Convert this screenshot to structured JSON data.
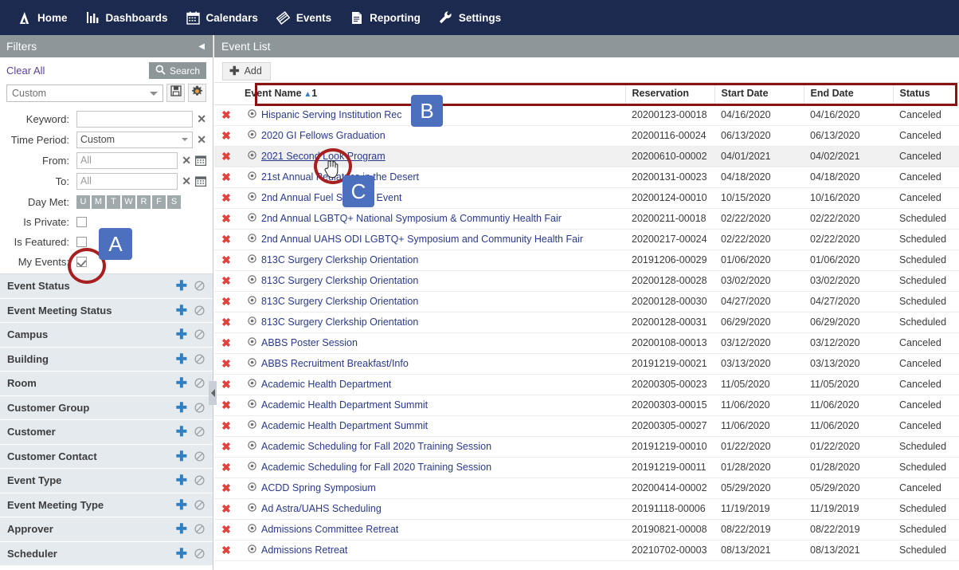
{
  "topnav": {
    "items": [
      {
        "label": "Home",
        "icon": "logo-a-icon"
      },
      {
        "label": "Dashboards",
        "icon": "bar-chart-icon"
      },
      {
        "label": "Calendars",
        "icon": "calendar-icon"
      },
      {
        "label": "Events",
        "icon": "diamond-icon"
      },
      {
        "label": "Reporting",
        "icon": "document-icon"
      },
      {
        "label": "Settings",
        "icon": "wrench-icon"
      }
    ]
  },
  "sidebar": {
    "header_title": "Filters",
    "collapse_icon": "chevron-left-icon",
    "clear_all": "Clear All",
    "search_label": "Search",
    "search_icon": "search-icon",
    "saved_filter_value": "Custom",
    "save_icon": "save-disk-icon",
    "settings_icon": "gear-icon",
    "filters": [
      {
        "label": "Keyword:",
        "value": "",
        "type": "text",
        "clear_icon": "clear-x-icon"
      },
      {
        "label": "Time Period:",
        "value": "Custom",
        "type": "select",
        "clear_icon": "clear-x-icon"
      },
      {
        "label": "From:",
        "value": "All",
        "type": "date",
        "clear_icon": "clear-x-icon",
        "cal_icon": "calendar-icon"
      },
      {
        "label": "To:",
        "value": "All",
        "type": "date",
        "clear_icon": "clear-x-icon",
        "cal_icon": "calendar-icon"
      }
    ],
    "day_met_label": "Day Met:",
    "day_met": [
      "U",
      "M",
      "T",
      "W",
      "R",
      "F",
      "S"
    ],
    "checkboxes": [
      {
        "label": "Is Private:",
        "checked": false
      },
      {
        "label": "Is Featured:",
        "checked": false
      },
      {
        "label": "My Events:",
        "checked": true
      }
    ],
    "accordion": [
      {
        "label": "Event Status",
        "add_icon": "plus-icon",
        "exclude_icon": "no-entry-icon"
      },
      {
        "label": "Event Meeting Status",
        "add_icon": "plus-icon",
        "exclude_icon": "no-entry-icon"
      },
      {
        "label": "Campus",
        "add_icon": "plus-icon",
        "exclude_icon": "no-entry-icon"
      },
      {
        "label": "Building",
        "add_icon": "plus-icon",
        "exclude_icon": "no-entry-icon"
      },
      {
        "label": "Room",
        "add_icon": "plus-icon",
        "exclude_icon": "no-entry-icon"
      },
      {
        "label": "Customer Group",
        "add_icon": "plus-icon",
        "exclude_icon": "no-entry-icon"
      },
      {
        "label": "Customer",
        "add_icon": "plus-icon",
        "exclude_icon": "no-entry-icon"
      },
      {
        "label": "Customer Contact",
        "add_icon": "plus-icon",
        "exclude_icon": "no-entry-icon"
      },
      {
        "label": "Event Type",
        "add_icon": "plus-icon",
        "exclude_icon": "no-entry-icon"
      },
      {
        "label": "Event Meeting Type",
        "add_icon": "plus-icon",
        "exclude_icon": "no-entry-icon"
      },
      {
        "label": "Approver",
        "add_icon": "plus-icon",
        "exclude_icon": "no-entry-icon"
      },
      {
        "label": "Scheduler",
        "add_icon": "plus-icon",
        "exclude_icon": "no-entry-icon"
      }
    ]
  },
  "main": {
    "header_title": "Event List",
    "add_label": "Add",
    "add_icon": "plus-icon",
    "columns": [
      {
        "key": "delete",
        "label": ""
      },
      {
        "key": "name",
        "label": "Event Name",
        "sorted": true,
        "sort_dir": "asc",
        "sort_order": "1"
      },
      {
        "key": "reservation",
        "label": "Reservation"
      },
      {
        "key": "start",
        "label": "Start Date"
      },
      {
        "key": "end",
        "label": "End Date"
      },
      {
        "key": "status",
        "label": "Status"
      }
    ],
    "sort_indicator": "▲",
    "rows": [
      {
        "name": "Hispanic Serving Institution Rec",
        "reservation": "20200123-00018",
        "start": "04/16/2020",
        "end": "04/16/2020",
        "status": "Canceled"
      },
      {
        "name": "2020 GI Fellows Graduation",
        "reservation": "20200116-00024",
        "start": "06/13/2020",
        "end": "06/13/2020",
        "status": "Canceled"
      },
      {
        "name": "2021 Second Look Program",
        "reservation": "20200610-00002",
        "start": "04/01/2021",
        "end": "04/02/2021",
        "status": "Canceled",
        "hovered": true
      },
      {
        "name": "21st Annual Pediatrics in the Desert",
        "reservation": "20200131-00023",
        "start": "04/18/2020",
        "end": "04/18/2020",
        "status": "Canceled"
      },
      {
        "name": "2nd Annual Fuel Summer Event",
        "reservation": "20200124-00010",
        "start": "10/15/2020",
        "end": "10/16/2020",
        "status": "Canceled"
      },
      {
        "name": "2nd Annual LGBTQ+ National Symposium & Communtiy Health Fair",
        "reservation": "20200211-00018",
        "start": "02/22/2020",
        "end": "02/22/2020",
        "status": "Scheduled"
      },
      {
        "name": "2nd Annual UAHS ODI LGBTQ+ Symposium and Community Health Fair",
        "reservation": "20200217-00024",
        "start": "02/22/2020",
        "end": "02/22/2020",
        "status": "Scheduled"
      },
      {
        "name": "813C Surgery Clerkship Orientation",
        "reservation": "20191206-00029",
        "start": "01/06/2020",
        "end": "01/06/2020",
        "status": "Scheduled"
      },
      {
        "name": "813C Surgery Clerkship Orientation",
        "reservation": "20200128-00028",
        "start": "03/02/2020",
        "end": "03/02/2020",
        "status": "Scheduled"
      },
      {
        "name": "813C Surgery Clerkship Orientation",
        "reservation": "20200128-00030",
        "start": "04/27/2020",
        "end": "04/27/2020",
        "status": "Scheduled"
      },
      {
        "name": "813C Surgery Clerkship Orientation",
        "reservation": "20200128-00031",
        "start": "06/29/2020",
        "end": "06/29/2020",
        "status": "Scheduled"
      },
      {
        "name": "ABBS Poster Session",
        "reservation": "20200108-00013",
        "start": "03/12/2020",
        "end": "03/12/2020",
        "status": "Canceled"
      },
      {
        "name": "ABBS Recruitment Breakfast/Info",
        "reservation": "20191219-00021",
        "start": "03/13/2020",
        "end": "03/13/2020",
        "status": "Canceled"
      },
      {
        "name": "Academic Health Department",
        "reservation": "20200305-00023",
        "start": "11/05/2020",
        "end": "11/05/2020",
        "status": "Canceled"
      },
      {
        "name": "Academic Health Department Summit",
        "reservation": "20200303-00015",
        "start": "11/06/2020",
        "end": "11/06/2020",
        "status": "Canceled"
      },
      {
        "name": "Academic Health Department Summit",
        "reservation": "20200305-00027",
        "start": "11/06/2020",
        "end": "11/06/2020",
        "status": "Canceled"
      },
      {
        "name": "Academic Scheduling for Fall 2020 Training Session",
        "reservation": "20191219-00010",
        "start": "01/22/2020",
        "end": "01/22/2020",
        "status": "Scheduled"
      },
      {
        "name": "Academic Scheduling for Fall 2020 Training Session",
        "reservation": "20191219-00011",
        "start": "01/28/2020",
        "end": "01/28/2020",
        "status": "Scheduled"
      },
      {
        "name": "ACDD Spring Symposium",
        "reservation": "20200414-00002",
        "start": "05/29/2020",
        "end": "05/29/2020",
        "status": "Canceled"
      },
      {
        "name": "Ad Astra/UAHS Scheduling",
        "reservation": "20191118-00006",
        "start": "11/19/2019",
        "end": "11/19/2019",
        "status": "Scheduled"
      },
      {
        "name": "Admissions Committee Retreat",
        "reservation": "20190821-00008",
        "start": "08/22/2019",
        "end": "08/22/2019",
        "status": "Scheduled"
      },
      {
        "name": "Admissions Retreat",
        "reservation": "20210702-00003",
        "start": "08/13/2021",
        "end": "08/13/2021",
        "status": "Scheduled"
      }
    ],
    "row_delete_icon": "delete-x-icon",
    "row_target_icon": "target-icon"
  },
  "annotations": {
    "badges": [
      {
        "label": "A"
      },
      {
        "label": "B"
      },
      {
        "label": "C"
      }
    ],
    "badge_color": "#4c6fbe",
    "highlight_color": "#8c1111",
    "circle_color": "#a81f1f"
  }
}
